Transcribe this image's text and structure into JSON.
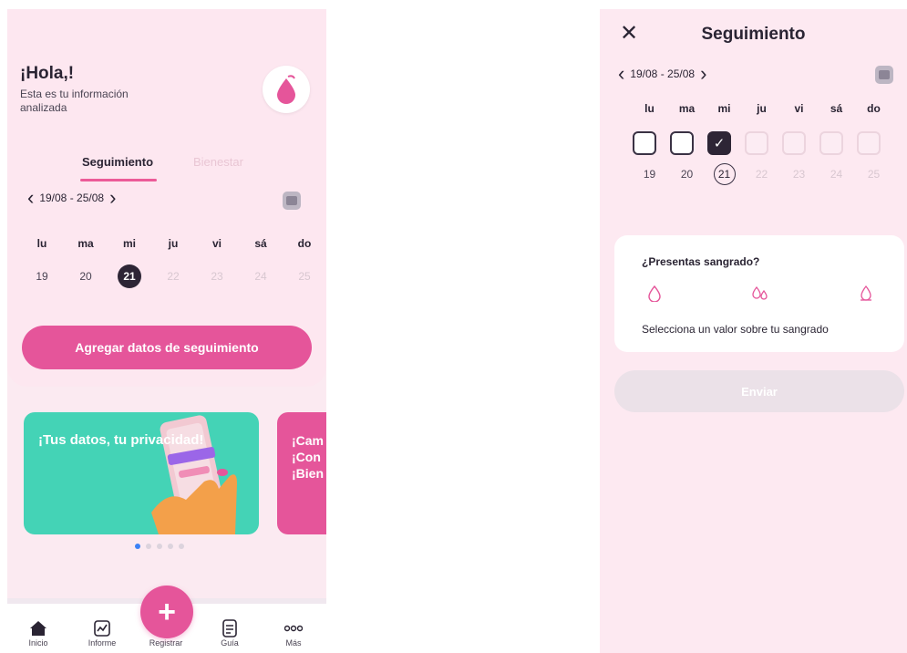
{
  "left": {
    "greeting": {
      "title": "¡Hola,!",
      "subtitle": "Esta es tu información analizada"
    },
    "tabs": [
      {
        "label": "Seguimiento"
      },
      {
        "label": "Bienestar"
      }
    ],
    "week": {
      "range": "19/08 - 25/08"
    },
    "days": [
      "lu",
      "ma",
      "mi",
      "ju",
      "vi",
      "sá",
      "do"
    ],
    "dates": [
      "19",
      "20",
      "21",
      "22",
      "23",
      "24",
      "25"
    ],
    "selected_date": "21",
    "add_button": "Agregar datos de seguimiento",
    "banners": [
      {
        "text": "¡Tus datos, tu privacidad!",
        "color": "#44d3b6"
      },
      {
        "text": "¡Cam\n¡Con\n¡Bien",
        "color": "#e5559a"
      }
    ],
    "carousel": {
      "total": 5,
      "active": 1
    },
    "nav": [
      {
        "label": "Inicio",
        "icon": "home-icon"
      },
      {
        "label": "Informe",
        "icon": "chart-icon"
      },
      {
        "label": "Registrar",
        "icon": "plus-icon"
      },
      {
        "label": "Guía",
        "icon": "guide-icon"
      },
      {
        "label": "Más",
        "icon": "more-icon"
      }
    ]
  },
  "right": {
    "title": "Seguimiento",
    "close_icon": "close-icon",
    "week": {
      "range": "19/08 - 25/08"
    },
    "days": [
      "lu",
      "ma",
      "mi",
      "ju",
      "vi",
      "sá",
      "do"
    ],
    "dates": [
      "19",
      "20",
      "21",
      "22",
      "23",
      "24",
      "25"
    ],
    "question": {
      "title": "¿Presentas sangrado?",
      "hint": "Selecciona un valor sobre tu sangrado",
      "icons": [
        "drop-icon",
        "drops-icon",
        "pad-icon"
      ]
    },
    "send_button": "Enviar"
  },
  "colors": {
    "accent": "#e5559a",
    "teal": "#44d3b6",
    "dark": "#2d2535",
    "bg": "#fde9f1"
  }
}
